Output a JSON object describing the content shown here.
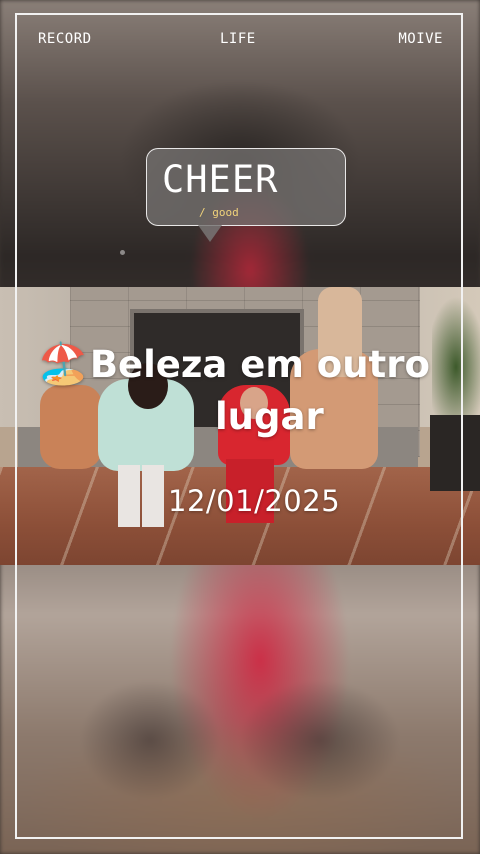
{
  "header": {
    "left_label": "RECORD",
    "center_label": "LIFE",
    "right_label": "MOIVE"
  },
  "bubble": {
    "title": "CHEER",
    "subtitle": "/ good"
  },
  "post": {
    "emoji": "🏖️",
    "title_line1": "Beleza em outro",
    "title_line2": "lugar",
    "date": "12/01/2025"
  },
  "colors": {
    "frame": "#f2f2f2",
    "bubble_subtitle": "#f0d27a",
    "text": "#ffffff"
  }
}
